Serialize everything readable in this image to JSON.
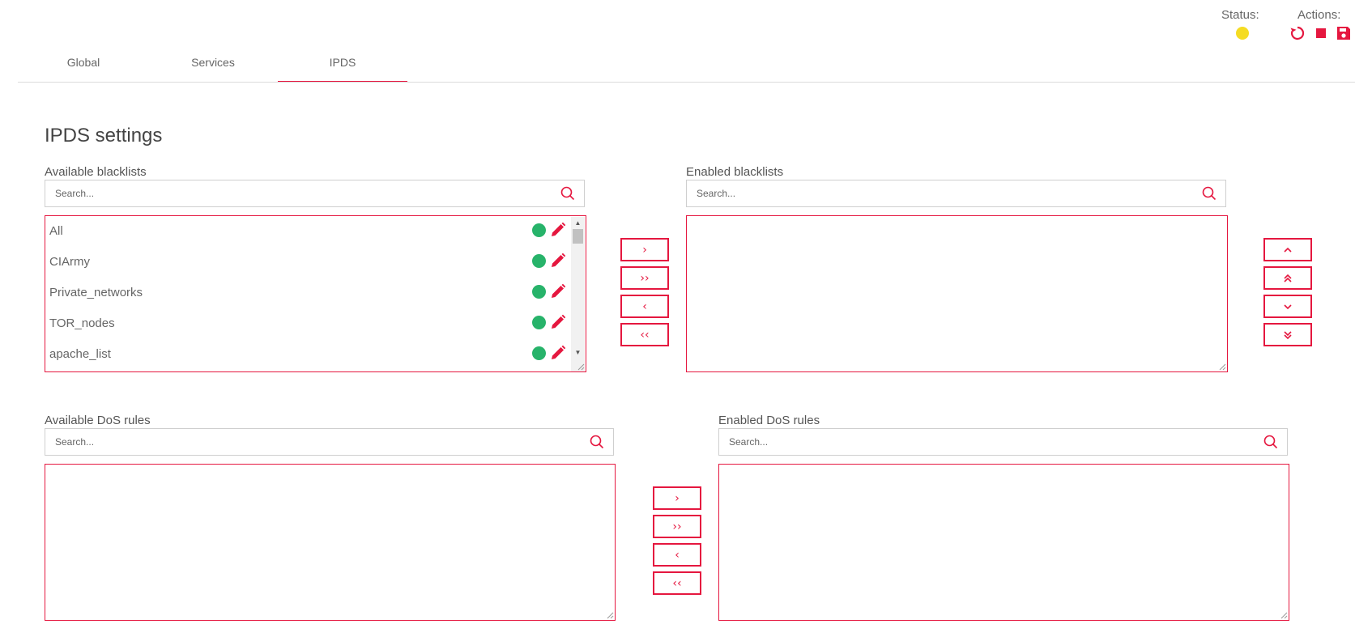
{
  "header": {
    "status_label": "Status:",
    "actions_label": "Actions:",
    "status_color": "#f5dc23",
    "accent_color": "#e5173f",
    "actions": [
      "restart-icon",
      "stop-icon",
      "save-icon"
    ]
  },
  "tabs": [
    {
      "label": "Global",
      "active": false
    },
    {
      "label": "Services",
      "active": false
    },
    {
      "label": "IPDS",
      "active": true
    }
  ],
  "page": {
    "title": "IPDS settings"
  },
  "available_blacklists": {
    "label": "Available blacklists",
    "search_placeholder": "Search...",
    "items": [
      {
        "name": "All",
        "status": "enabled"
      },
      {
        "name": "CIArmy",
        "status": "enabled"
      },
      {
        "name": "Private_networks",
        "status": "enabled"
      },
      {
        "name": "TOR_nodes",
        "status": "enabled"
      },
      {
        "name": "apache_list",
        "status": "enabled"
      }
    ]
  },
  "enabled_blacklists": {
    "label": "Enabled blacklists",
    "search_placeholder": "Search...",
    "items": []
  },
  "available_dos_rules": {
    "label": "Available DoS rules",
    "search_placeholder": "Search...",
    "items": []
  },
  "enabled_dos_rules": {
    "label": "Enabled DoS rules",
    "search_placeholder": "Search...",
    "items": []
  },
  "transfer_buttons": {
    "move_right": "›",
    "move_all_right": "››",
    "move_left": "‹",
    "move_all_left": "‹‹"
  },
  "order_buttons": [
    "chevron-up-icon",
    "double-chevron-up-icon",
    "chevron-down-icon",
    "double-chevron-down-icon"
  ]
}
